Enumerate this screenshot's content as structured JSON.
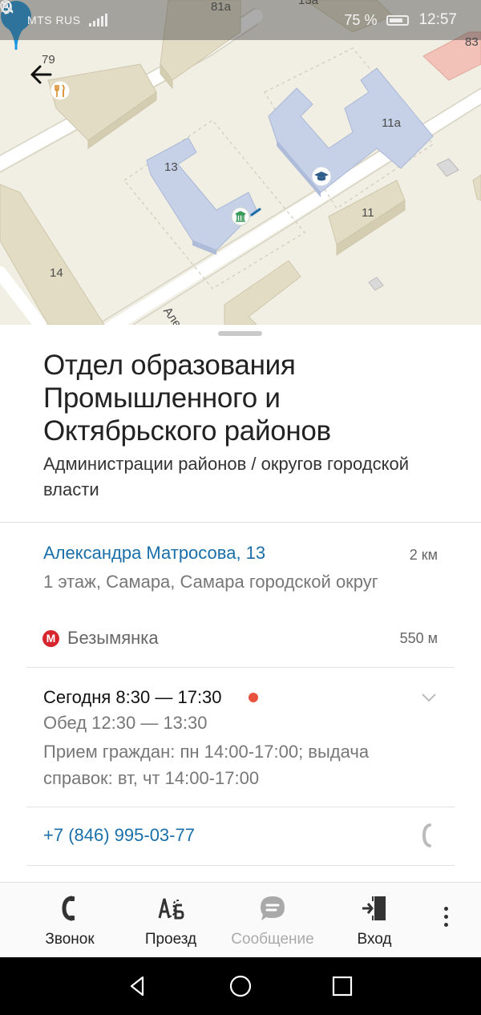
{
  "status_bar": {
    "carrier": "MTS RUS",
    "battery": "75 %",
    "time": "12:57"
  },
  "map": {
    "labels": {
      "b81a": "81a",
      "b79": "79",
      "b13": "13",
      "b11a": "11a",
      "b11": "11",
      "b14": "14",
      "b83": "83",
      "b13a": "13a",
      "street": "Але"
    },
    "icons": [
      "restaurant-icon",
      "education-icon",
      "government-icon",
      "back-arrow-icon"
    ],
    "pin_color": "#1a98e0"
  },
  "place": {
    "title": "Отдел образования Промышленного и Октябрьского районов",
    "category": "Администрации районов / округов городской власти",
    "address": "Александра Матросова, 13",
    "distance": "2 км",
    "address_detail": "1 этаж, Самара, Самара городской округ",
    "metro": {
      "icon_letter": "М",
      "name": "Безымянка",
      "distance": "550 м"
    },
    "hours": {
      "today": "Сегодня 8:30 — 17:30",
      "lunch": "Обед 12:30 — 13:30",
      "note": "Прием граждан: пн 14:00-17:00; выдача справок: вт, чт 14:00-17:00"
    },
    "phone": "+7 (846) 995-03-77"
  },
  "actions": [
    {
      "label": "Звонок",
      "icon": "phone-icon"
    },
    {
      "label": "Проезд",
      "icon": "route-icon"
    },
    {
      "label": "Сообщение",
      "icon": "chat-icon"
    },
    {
      "label": "Вход",
      "icon": "entrance-icon"
    }
  ],
  "colors": {
    "link": "#1a6fa8",
    "status_dot": "#e8533f",
    "metro": "#d6252d"
  }
}
